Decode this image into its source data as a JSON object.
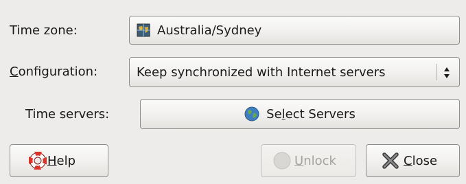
{
  "time_zone": {
    "label_pre": "Time zone:",
    "value": "Australia/Sydney"
  },
  "configuration": {
    "label_mnemonic": "C",
    "label_rest": "onfiguration:",
    "selected": "Keep synchronized with Internet servers"
  },
  "time_servers": {
    "label": "Time servers:",
    "button_pre": "Se",
    "button_mnemonic": "l",
    "button_post": "ect Servers"
  },
  "buttons": {
    "help_mnemonic": "H",
    "help_rest": "elp",
    "unlock_mnemonic": "U",
    "unlock_rest": "nlock",
    "close_mnemonic": "C",
    "close_rest": "lose"
  },
  "icons": {
    "timezone": "world-map-icon",
    "servers": "globe-icon",
    "help": "lifebuoy-icon",
    "unlock": "unlock-icon",
    "close": "close-x-icon",
    "combo": "up-down-arrows-icon"
  }
}
